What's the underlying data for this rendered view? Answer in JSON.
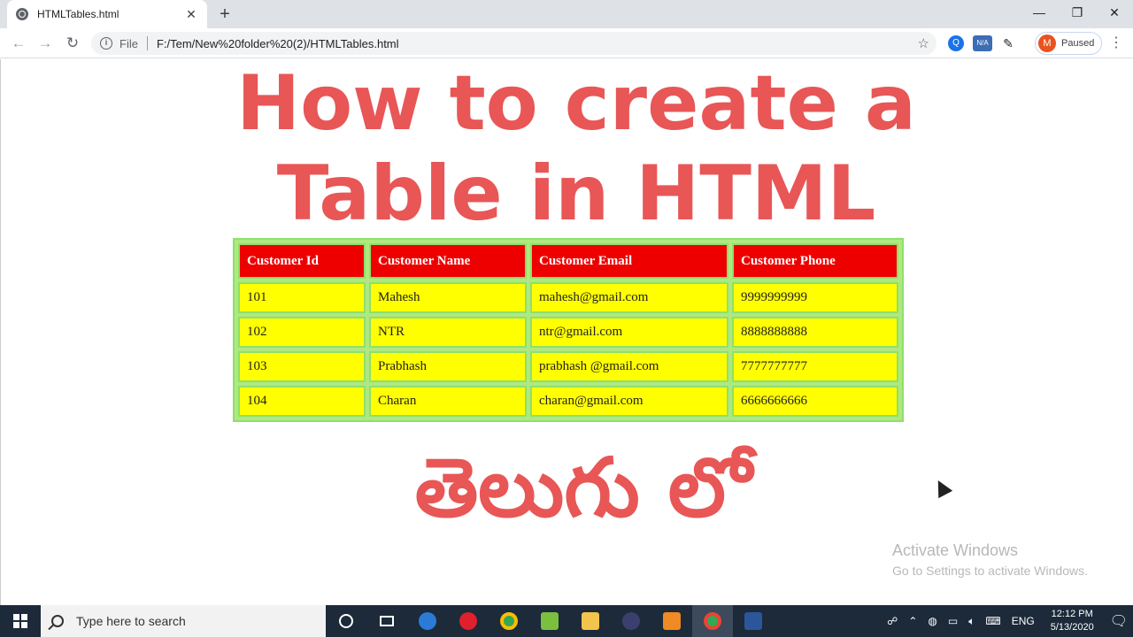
{
  "browser": {
    "tab_title": "HTMLTables.html",
    "tab_close": "✕",
    "new_tab": "+",
    "window_controls": {
      "minimize": "—",
      "restore": "❐",
      "close": "✕"
    },
    "nav": {
      "back": "←",
      "forward": "→",
      "reload": "↻"
    },
    "address": {
      "info": "i",
      "scheme": "File",
      "url": "F:/Tem/New%20folder%20(2)/HTMLTables.html",
      "bookmark": "☆"
    },
    "extensions": {
      "na_label": "N/A"
    },
    "profile": {
      "initial": "M",
      "status": "Paused"
    },
    "menu": "⋮"
  },
  "page": {
    "headline_line1": "How to create a",
    "headline_line2": "Table in HTML",
    "telugu_text": "తెలుగు లో",
    "table": {
      "headers": [
        "Customer Id",
        "Customer Name",
        "Customer Email",
        "Customer Phone"
      ],
      "rows": [
        [
          "101",
          "Mahesh",
          "mahesh@gmail.com",
          "9999999999"
        ],
        [
          "102",
          "NTR",
          "ntr@gmail.com",
          "8888888888"
        ],
        [
          "103",
          "Prabhash",
          "prabhash @gmail.com",
          "7777777777"
        ],
        [
          "104",
          "Charan",
          "charan@gmail.com",
          "6666666666"
        ]
      ]
    }
  },
  "watermark": {
    "line1": "Activate Windows",
    "line2": "Go to Settings to activate Windows."
  },
  "taskbar": {
    "search_placeholder": "Type here to search",
    "language": "ENG",
    "time": "12:12 PM",
    "date": "5/13/2020"
  },
  "colors": {
    "headline": "#e85656",
    "header_bg": "#ee0000",
    "cell_bg": "#ffff00",
    "border": "#8ee06a"
  }
}
